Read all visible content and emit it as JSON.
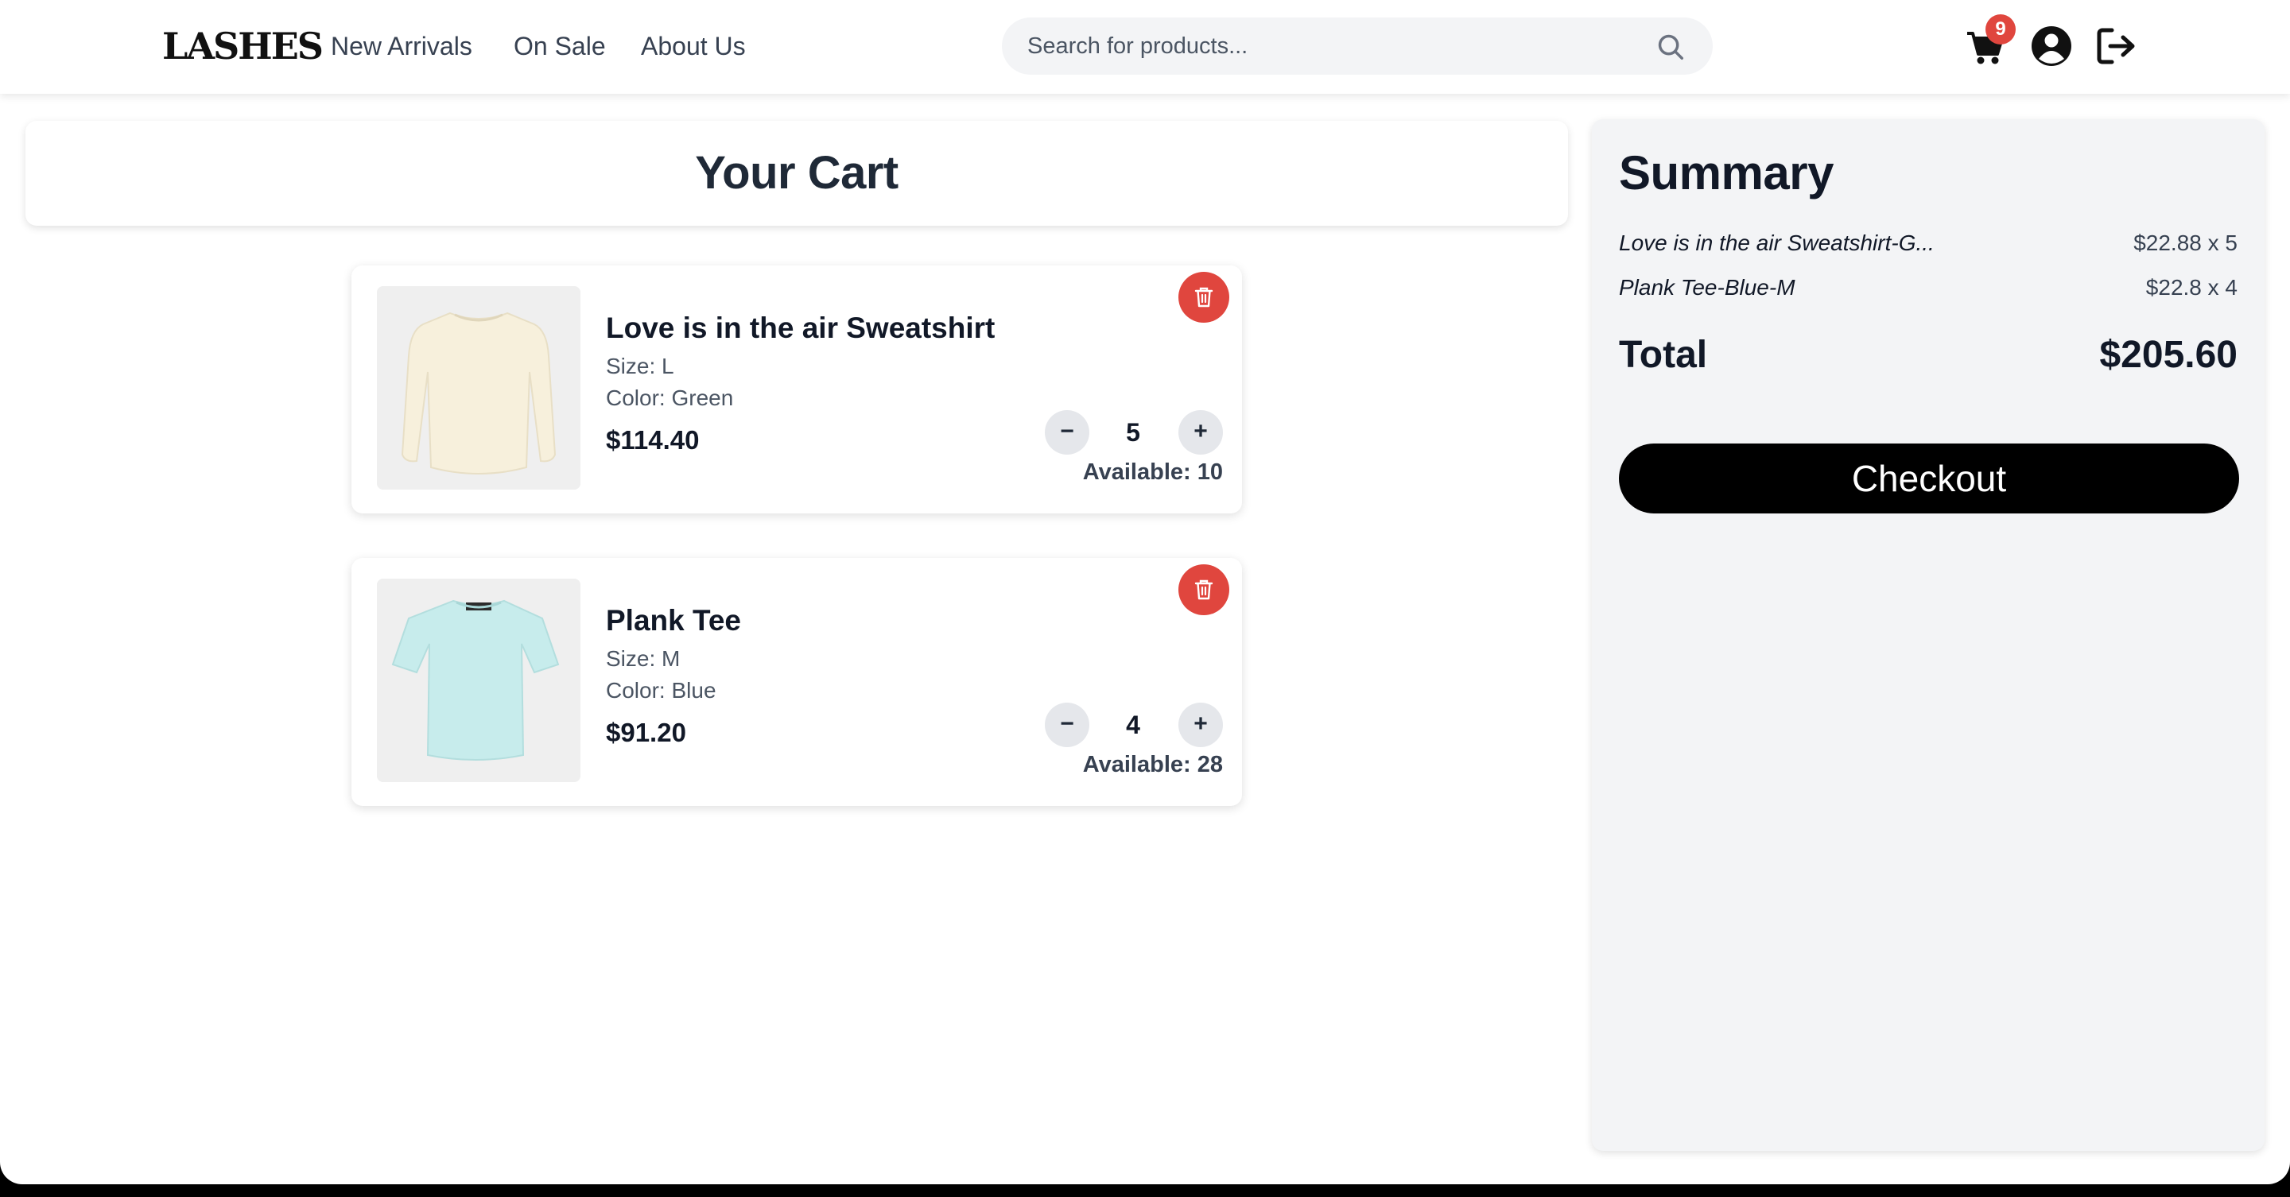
{
  "header": {
    "logo_text": "LASHES",
    "nav": [
      "New Arrivals",
      "On Sale",
      "About Us"
    ],
    "search_placeholder": "Search for products...",
    "cart_count": "9",
    "icons": [
      "search-icon",
      "cart-icon",
      "user-account-icon",
      "logout-icon"
    ]
  },
  "cart": {
    "title": "Your Cart",
    "items": [
      {
        "name": "Love is in the air Sweatshirt",
        "size": "Size: L",
        "color": "Color: Green",
        "price": "$114.40",
        "quantity": "5",
        "available": "Available: 10",
        "minus": "−",
        "plus": "+"
      },
      {
        "name": "Plank Tee",
        "size": "Size: M",
        "color": "Color: Blue",
        "price": "$91.20",
        "quantity": "4",
        "available": "Available: 28",
        "minus": "−",
        "plus": "+"
      }
    ]
  },
  "summary": {
    "title": "Summary",
    "lines": [
      {
        "name": "Love is in the air Sweatshirt-G...",
        "amount": "$22.88 x 5"
      },
      {
        "name": "Plank Tee-Blue-M",
        "amount": "$22.8 x 4"
      }
    ],
    "total_label": "Total",
    "total_value": "$205.60",
    "checkout_label": "Checkout"
  },
  "colors": {
    "accent_red": "#e0463e",
    "checkout_black": "#000000",
    "summary_bg": "#f3f4f6",
    "text_dark": "#111827"
  }
}
